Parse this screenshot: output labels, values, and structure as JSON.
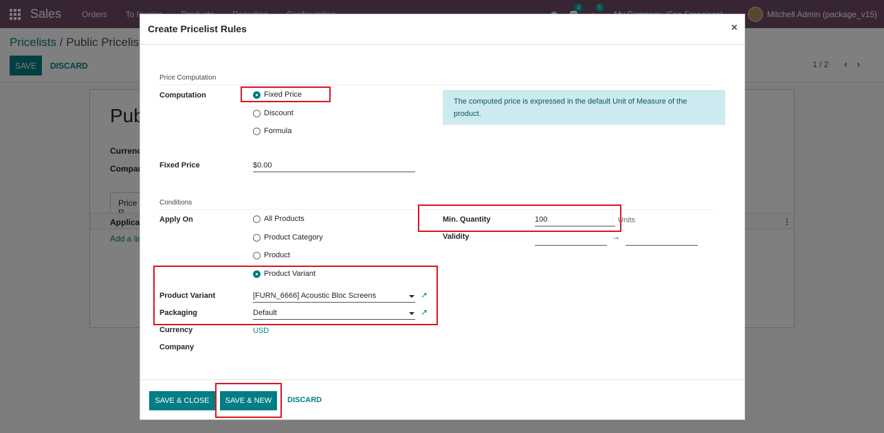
{
  "navbar": {
    "app_name": "Sales",
    "menu": [
      "Orders",
      "To Invoice",
      "Products",
      "Reporting",
      "Configuration"
    ],
    "messages_count": "4",
    "activities_count": "5",
    "company": "My Company (San Francisco)",
    "user": "Mitchell Admin (package_v15)"
  },
  "page": {
    "breadcrumb_parent": "Pricelists",
    "breadcrumb_sep": " / ",
    "breadcrumb_current": "Public Pricelist",
    "save_label": "SAVE",
    "discard_label": "DISCARD",
    "pager": "1 / 2",
    "record_title": "Pub",
    "currency_label": "Currency",
    "company_label": "Company",
    "tab_label": "Price R",
    "table_head": "Applicab",
    "add_line": "Add a lin"
  },
  "modal": {
    "title": "Create Pricelist Rules",
    "close": "×",
    "price_computation_section": "Price Computation",
    "computation_label": "Computation",
    "computation_options": [
      "Fixed Price",
      "Discount",
      "Formula"
    ],
    "computation_selected": "Fixed Price",
    "info_text": "The computed price is expressed in the default Unit of Measure of the product.",
    "fixed_price_label": "Fixed Price",
    "fixed_price_currency": "$",
    "fixed_price_value": "0.00",
    "conditions_section": "Conditions",
    "apply_on_label": "Apply On",
    "apply_on_options": [
      "All Products",
      "Product Category",
      "Product",
      "Product Variant"
    ],
    "apply_on_selected": "Product Variant",
    "min_quantity_label": "Min. Quantity",
    "min_quantity_value": "100",
    "min_quantity_unit": "Units",
    "validity_label": "Validity",
    "validity_arrow": "→",
    "product_variant_label": "Product Variant",
    "product_variant_value": "[FURN_6666] Acoustic Bloc Screens",
    "packaging_label": "Packaging",
    "packaging_value": "Default",
    "currency_label": "Currency",
    "currency_value": "USD",
    "company_label": "Company",
    "save_close_label": "SAVE & CLOSE",
    "save_new_label": "SAVE & NEW",
    "discard_label": "DISCARD"
  },
  "colors": {
    "brand": "#714b67",
    "primary": "#017e84",
    "highlight": "#d9141e",
    "info_bg": "#cdeaf0"
  }
}
